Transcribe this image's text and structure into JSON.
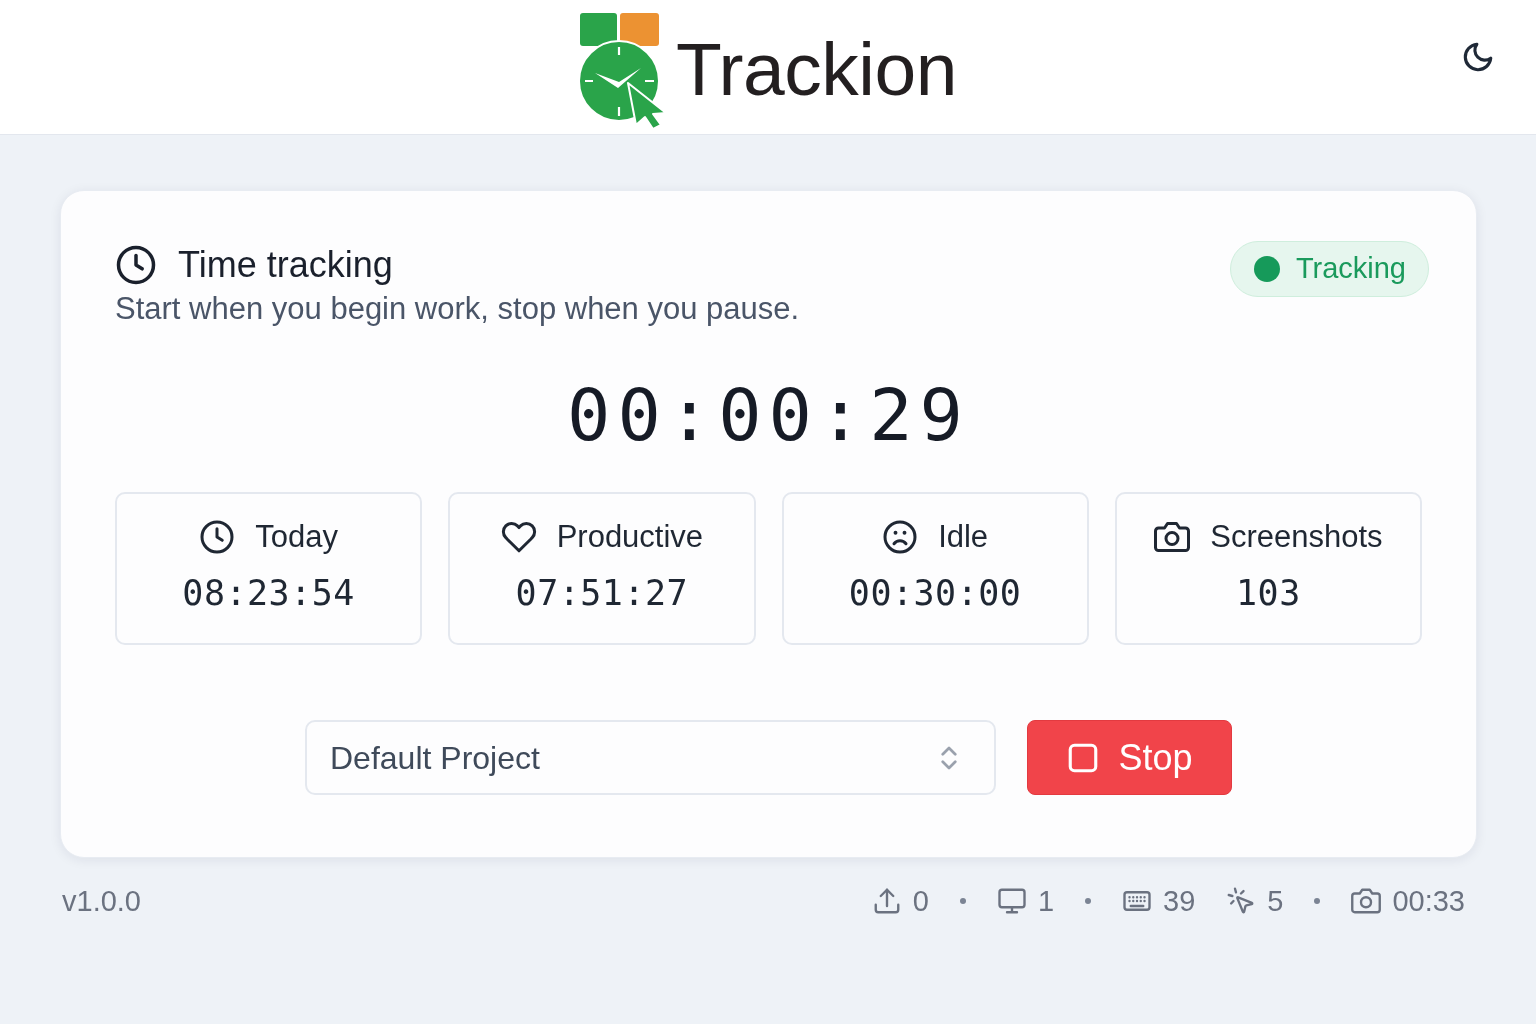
{
  "header": {
    "logo_text": "Trackion"
  },
  "card": {
    "title": "Time tracking",
    "subtitle": "Start when you begin work, stop when you pause.",
    "status": {
      "label": "Tracking",
      "active": true
    },
    "timer": "00:00:29",
    "stats": [
      {
        "kind": "total",
        "label": "Today",
        "value": "08:23:54"
      },
      {
        "kind": "productive",
        "label": "Productive",
        "value": "07:51:27"
      },
      {
        "kind": "idle",
        "label": "Idle",
        "value": "00:30:00"
      },
      {
        "kind": "screenshots",
        "label": "Screenshots",
        "value": "103"
      }
    ],
    "project_select": {
      "value": "Default Project"
    },
    "stop_button": {
      "label": "Stop"
    }
  },
  "footer": {
    "version": "v1.0.0",
    "stats": [
      {
        "kind": "uploads",
        "value": "0",
        "separator_after": true
      },
      {
        "kind": "displays",
        "value": "1",
        "separator_after": true
      },
      {
        "kind": "keystrokes",
        "value": "39",
        "separator_after": false
      },
      {
        "kind": "clicks",
        "value": "5",
        "separator_after": true
      },
      {
        "kind": "screenshot",
        "value": "00:33",
        "separator_after": false
      }
    ]
  }
}
